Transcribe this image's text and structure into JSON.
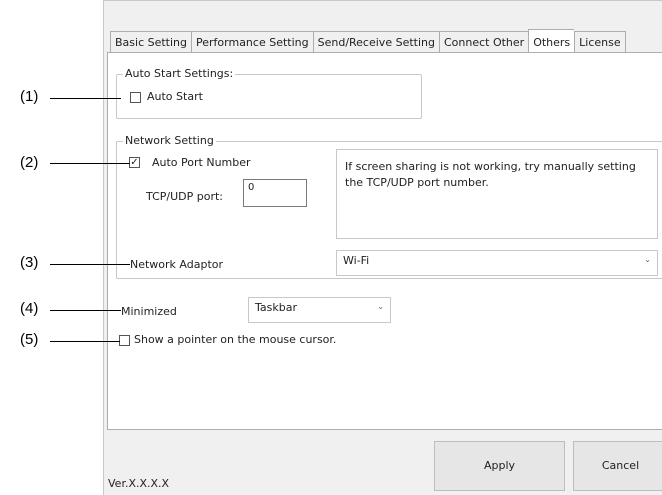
{
  "tabs": [
    "Basic Setting",
    "Performance Setting",
    "Send/Receive Setting",
    "Connect Other",
    "Others",
    "License"
  ],
  "active_tab": "Others",
  "auto_start": {
    "group_title": "Auto Start Settings:",
    "checkbox_label": "Auto Start",
    "checked": false
  },
  "network": {
    "group_title": "Network Setting",
    "auto_port_label": "Auto Port Number",
    "auto_port_checked": true,
    "port_label": "TCP/UDP port:",
    "port_value": "0",
    "info_text": "If screen sharing is not working, try manually setting the TCP/UDP port number.",
    "adapter_label": "Network Adaptor",
    "adapter_value": "Wi-Fi"
  },
  "minimized": {
    "label": "Minimized",
    "value": "Taskbar"
  },
  "pointer": {
    "label": "Show a pointer on the mouse cursor.",
    "checked": false
  },
  "buttons": {
    "apply": "Apply",
    "cancel": "Cancel"
  },
  "version": "Ver.X.X.X.X",
  "callouts": [
    "(1)",
    "(2)",
    "(3)",
    "(4)",
    "(5)"
  ],
  "icons": {
    "check": "check-mark-icon",
    "dropdown": "chevron-down-icon"
  }
}
